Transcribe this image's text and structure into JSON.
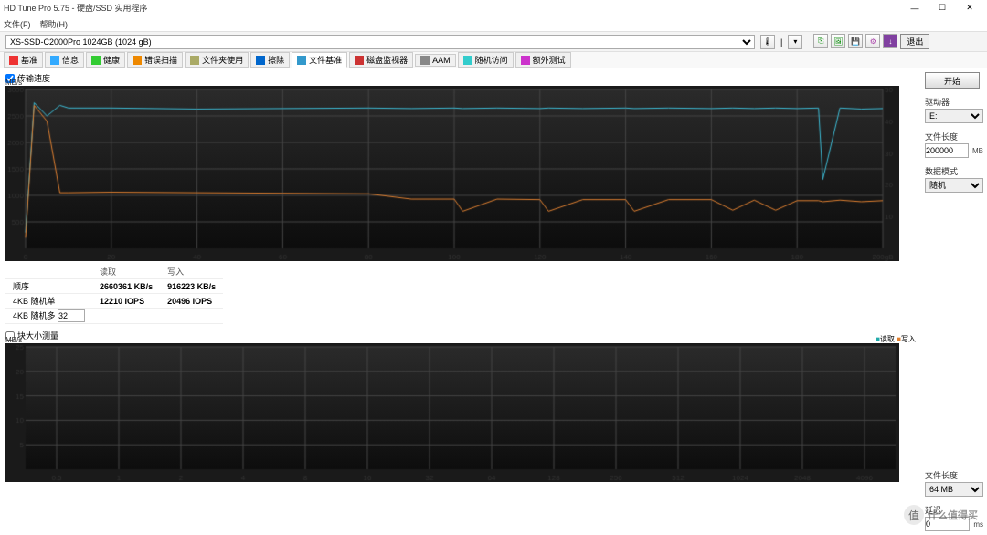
{
  "window": {
    "title": "HD Tune Pro 5.75 - 硬盘/SSD 实用程序",
    "min": "—",
    "max": "☐",
    "close": "✕"
  },
  "menu": {
    "file": "文件(F)",
    "help": "帮助(H)"
  },
  "device": {
    "selected": "XS-SSD-C2000Pro 1024GB (1024 gB)",
    "temp_icon": "🌡",
    "temp_sep": "|",
    "exit": "退出"
  },
  "tabs": [
    "基准",
    "信息",
    "健康",
    "错误扫描",
    "文件夹使用",
    "擦除",
    "文件基准",
    "磁盘监视器",
    "AAM",
    "随机访问",
    "额外测试"
  ],
  "right": {
    "start": "开始",
    "drive_label": "驱动器",
    "drive_value": "E:",
    "filelen_label": "文件长度",
    "filelen_value": "200000",
    "filelen_unit": "MB",
    "pattern_label": "数据模式",
    "pattern_value": "随机",
    "filelen2_label": "文件长度",
    "filelen2_value": "64 MB",
    "delay_label": "延迟",
    "delay_value": "0",
    "delay_unit": "ms"
  },
  "top_chart": {
    "checkbox": "传输速度",
    "y_unit": "MB/s",
    "y_ticks_left": [
      3000,
      2500,
      2000,
      1500,
      1000,
      500
    ],
    "y_ticks_right": [
      50,
      40,
      30,
      20,
      10
    ],
    "x_ticks": [
      0,
      20,
      40,
      60,
      80,
      100,
      120,
      140,
      160,
      180,
      "200gB"
    ]
  },
  "table": {
    "headers": [
      "",
      "读取",
      "写入"
    ],
    "rows": [
      {
        "label": "顺序",
        "read": "2660361 KB/s",
        "write": "916223 KB/s"
      },
      {
        "label": "4KB 随机单",
        "read": "12210 IOPS",
        "write": "20496 IOPS"
      },
      {
        "label": "4KB 随机多",
        "spin": "32",
        "read": "",
        "write": ""
      }
    ]
  },
  "bottom_chart": {
    "checkbox": "块大小测量",
    "y_unit": "MB/s",
    "y_ticks": [
      25,
      20,
      15,
      10,
      5
    ],
    "x_ticks": [
      "0.5",
      "1",
      "2",
      "4",
      "8",
      "16",
      "32",
      "64",
      "128",
      "256",
      "512",
      "1024",
      "2048",
      "4096"
    ],
    "legend_read": "读取",
    "legend_write": "写入"
  },
  "watermark": {
    "text": "什么值得买"
  },
  "chart_data": {
    "type": "line",
    "title": "传输速度",
    "xlabel": "gB",
    "ylabel": "MB/s",
    "xlim": [
      0,
      200
    ],
    "ylim": [
      0,
      3000
    ],
    "x": [
      0,
      2,
      5,
      8,
      10,
      20,
      40,
      60,
      80,
      90,
      100,
      102,
      110,
      120,
      122,
      130,
      140,
      142,
      150,
      160,
      165,
      170,
      175,
      180,
      185,
      186,
      190,
      195,
      200
    ],
    "series": [
      {
        "name": "读取",
        "color": "#3cbcd6",
        "values": [
          300,
          2750,
          2500,
          2700,
          2650,
          2650,
          2630,
          2640,
          2650,
          2640,
          2650,
          2640,
          2650,
          2640,
          2650,
          2640,
          2650,
          2640,
          2650,
          2640,
          2650,
          2640,
          2650,
          2640,
          2650,
          1300,
          2650,
          2630,
          2640
        ]
      },
      {
        "name": "写入",
        "color": "#e08030",
        "values": [
          200,
          2700,
          2400,
          1050,
          1050,
          1060,
          1050,
          1040,
          1030,
          930,
          930,
          700,
          930,
          920,
          700,
          920,
          920,
          700,
          920,
          920,
          720,
          910,
          720,
          900,
          900,
          880,
          910,
          880,
          900
        ]
      }
    ]
  }
}
